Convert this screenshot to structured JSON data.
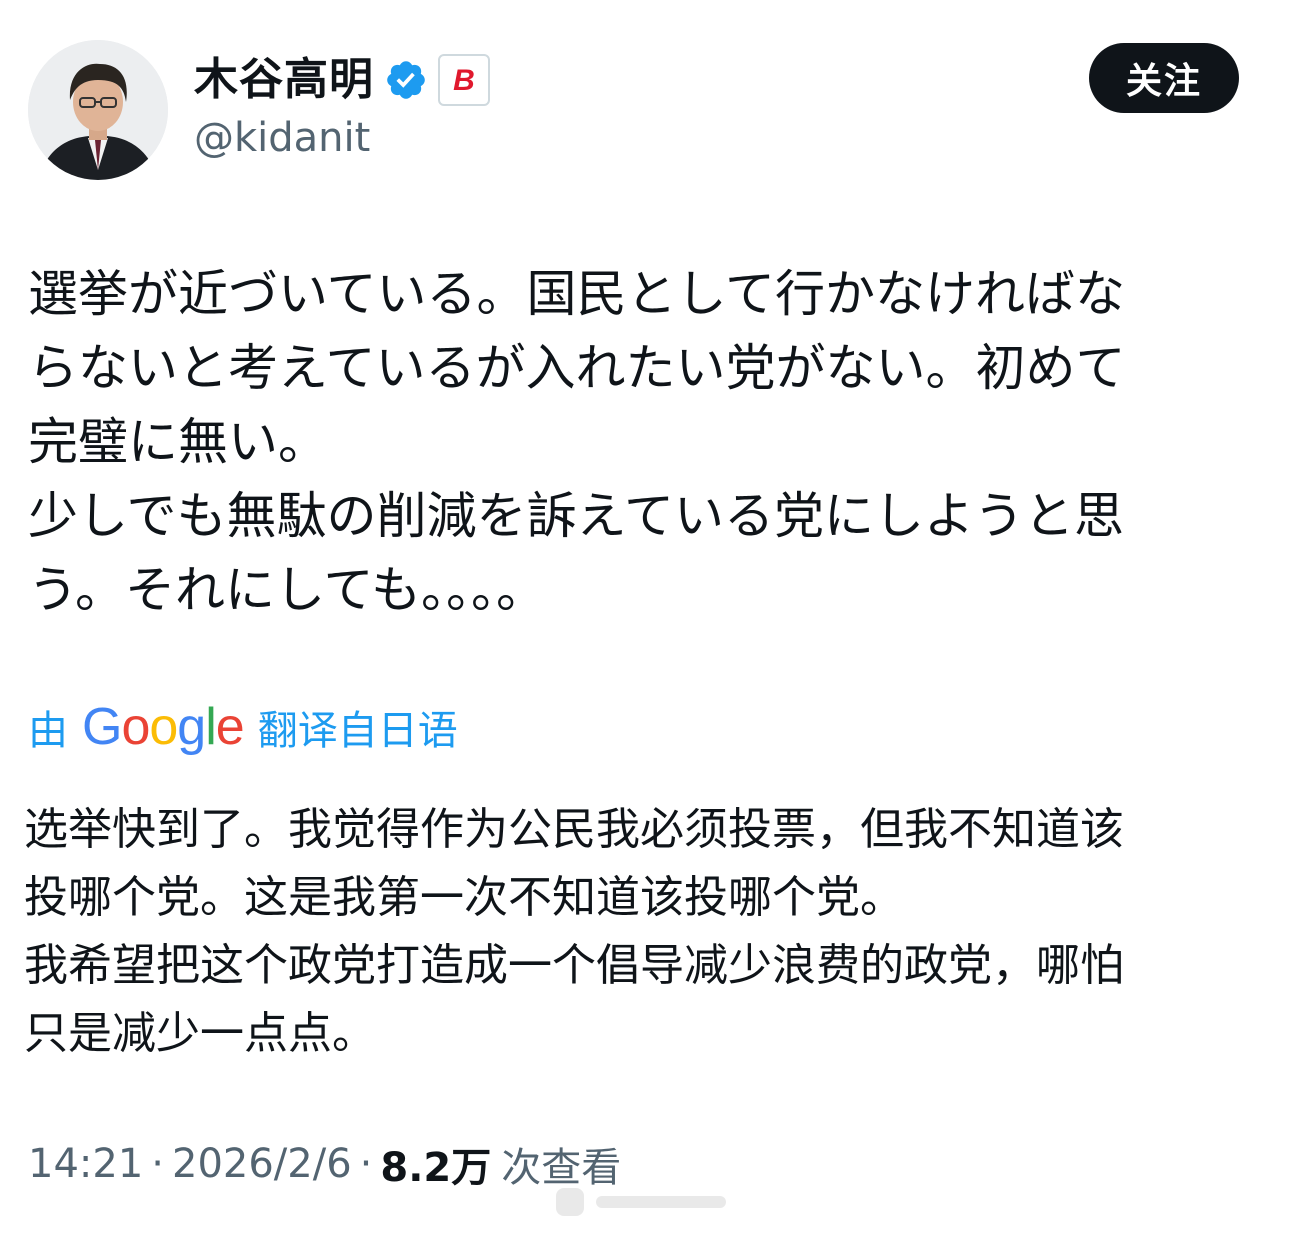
{
  "author": {
    "display_name": "木谷高明",
    "handle": "@kidanit",
    "verified_icon": "verified-badge-icon",
    "affiliate_badge_letter": "B"
  },
  "follow_button": {
    "label": "关注"
  },
  "tweet": {
    "original_lines": [
      "選挙が近づいている。国民として行かなければな",
      "らないと考えているが入れたい党がない。初めて",
      "完璧に無い。",
      "少しでも無駄の削減を訴えている党にしようと思",
      "う。それにしても。。。。"
    ],
    "translation": {
      "prefix": "由",
      "provider": "Google",
      "suffix": "翻译自日语"
    },
    "translated_lines": [
      "选举快到了。我觉得作为公民我必须投票，但我不知道该",
      "投哪个党。这是我第一次不知道该投哪个党。",
      "我希望把这个政党打造成一个倡导减少浪费的政党，哪怕",
      "只是减少一点点。"
    ]
  },
  "meta": {
    "time": "14:21",
    "separator": "·",
    "date": "2026/2/6",
    "views": "8.2万",
    "views_label": "次查看"
  },
  "colors": {
    "link": "#1d9bf0",
    "text": "#0f1419",
    "secondary": "#536471",
    "verified": "#1d9bf0",
    "badge_red": "#e0182d"
  }
}
